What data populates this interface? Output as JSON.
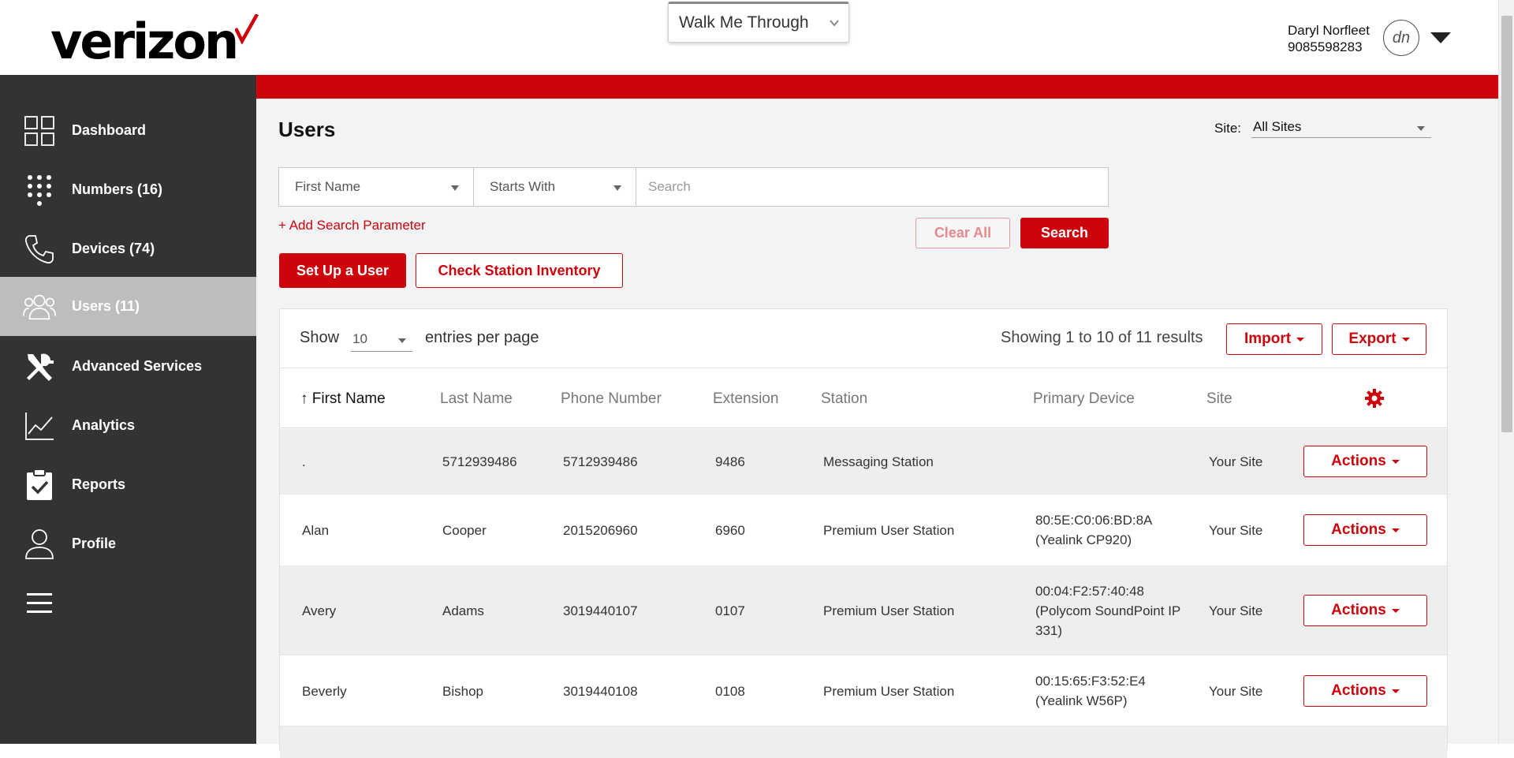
{
  "header": {
    "brand": "verizon",
    "walkme_label": "Walk Me Through",
    "user_name": "Daryl Norfleet",
    "user_phone": "9085598283",
    "avatar_initials": "dn"
  },
  "colors": {
    "brand_red": "#cd040b",
    "sidebar_bg": "#333333",
    "active_nav_bg": "#bdbdbd"
  },
  "sidebar": {
    "items": [
      {
        "label": "Dashboard",
        "icon": "dashboard-grid-icon"
      },
      {
        "label": "Numbers (16)",
        "icon": "dialpad-icon"
      },
      {
        "label": "Devices (74)",
        "icon": "phone-handset-icon"
      },
      {
        "label": "Users (11)",
        "icon": "users-group-icon",
        "active": true
      },
      {
        "label": "Advanced Services",
        "icon": "tools-icon"
      },
      {
        "label": "Analytics",
        "icon": "line-chart-icon"
      },
      {
        "label": "Reports",
        "icon": "clipboard-check-icon"
      },
      {
        "label": "Profile",
        "icon": "person-icon"
      }
    ],
    "menu_icon": "hamburger-menu-icon"
  },
  "main": {
    "title": "Users",
    "site_label": "Site:",
    "site_value": "All Sites",
    "search": {
      "field": "First Name",
      "operator": "Starts With",
      "placeholder": "Search",
      "add_param": "+ Add Search Parameter",
      "clear_label": "Clear All",
      "search_label": "Search"
    },
    "setup_label": "Set Up a User",
    "check_label": "Check Station Inventory"
  },
  "table": {
    "show_label": "Show",
    "per_page": "10",
    "per_page_label": "entries per page",
    "showing": "Showing 1 to 10 of 11 results",
    "import_label": "Import",
    "export_label": "Export",
    "sort_arrow": "↑",
    "columns": [
      "First Name",
      "Last Name",
      "Phone Number",
      "Extension",
      "Station",
      "Primary Device",
      "Site"
    ],
    "rows": [
      {
        "first": ".",
        "last": "5712939486",
        "phone": "5712939486",
        "ext": "9486",
        "station": "Messaging Station",
        "device": "",
        "site": "Your Site",
        "action": "Actions"
      },
      {
        "first": "Alan",
        "last": "Cooper",
        "phone": "2015206960",
        "ext": "6960",
        "station": "Premium User Station",
        "device": "80:5E:C0:06:BD:8A (Yealink CP920)",
        "site": "Your Site",
        "action": "Actions"
      },
      {
        "first": "Avery",
        "last": "Adams",
        "phone": "3019440107",
        "ext": "0107",
        "station": "Premium User Station",
        "device": "00:04:F2:57:40:48 (Polycom SoundPoint IP 331)",
        "site": "Your Site",
        "action": "Actions"
      },
      {
        "first": "Beverly",
        "last": "Bishop",
        "phone": "3019440108",
        "ext": "0108",
        "station": "Premium User Station",
        "device": "00:15:65:F3:52:E4 (Yealink W56P)",
        "site": "Your Site",
        "action": "Actions"
      }
    ]
  }
}
